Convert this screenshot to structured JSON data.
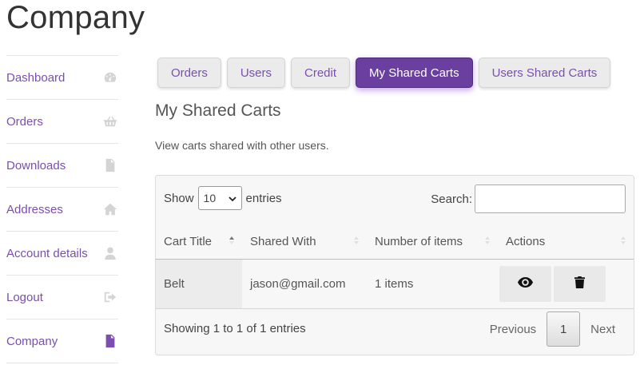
{
  "page": {
    "title": "Company"
  },
  "sidebar": {
    "items": [
      {
        "label": "Dashboard",
        "icon": "dashboard-gauge-icon"
      },
      {
        "label": "Orders",
        "icon": "basket-icon"
      },
      {
        "label": "Downloads",
        "icon": "file-download-icon"
      },
      {
        "label": "Addresses",
        "icon": "home-icon"
      },
      {
        "label": "Account details",
        "icon": "user-icon"
      },
      {
        "label": "Logout",
        "icon": "sign-out-icon"
      },
      {
        "label": "Company",
        "icon": "document-icon",
        "active": true
      }
    ]
  },
  "tabs": [
    {
      "label": "Orders"
    },
    {
      "label": "Users"
    },
    {
      "label": "Credit"
    },
    {
      "label": "My Shared Carts",
      "active": true
    },
    {
      "label": "Users Shared Carts"
    }
  ],
  "section": {
    "title": "My Shared Carts",
    "description": "View carts shared with other users."
  },
  "table": {
    "show_label": "Show",
    "entries_label": "entries",
    "page_length": "10",
    "search_label": "Search:",
    "search_value": "",
    "columns": [
      "Cart Title",
      "Shared With",
      "Number of items",
      "Actions"
    ],
    "rows": [
      {
        "cart_title": "Belt",
        "shared_with": "jason@gmail.com",
        "items": "1 items"
      }
    ],
    "info": "Showing 1 to 1 of 1 entries",
    "pagination": {
      "previous": "Previous",
      "current": "1",
      "next": "Next"
    }
  },
  "colors": {
    "accent": "#7b4eb0",
    "active_tab": "#6b3fa0"
  }
}
